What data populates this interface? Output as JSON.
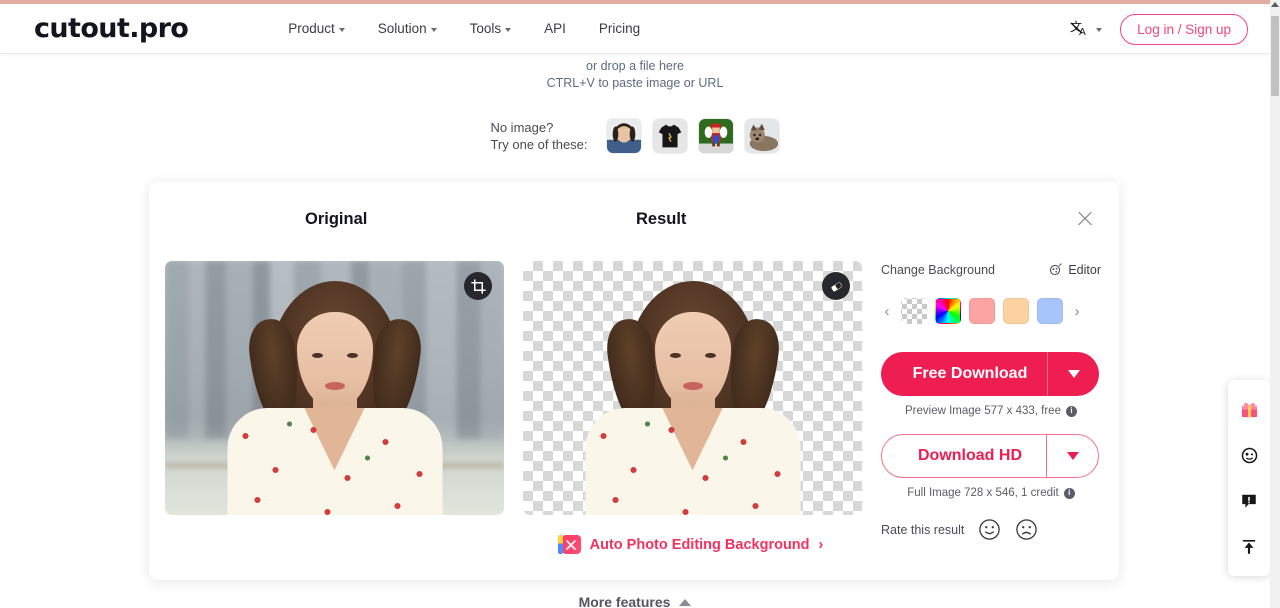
{
  "header": {
    "logo": "cutout.pro",
    "nav": [
      {
        "label": "Product",
        "has_caret": true
      },
      {
        "label": "Solution",
        "has_caret": true
      },
      {
        "label": "Tools",
        "has_caret": true
      },
      {
        "label": "API",
        "has_caret": false
      },
      {
        "label": "Pricing",
        "has_caret": false
      }
    ],
    "language_icon": "translate-icon",
    "login_label": "Log in / Sign up"
  },
  "upload": {
    "drop_hint": "or drop a file here",
    "paste_hint": "CTRL+V to paste image or URL",
    "no_image_line1": "No image?",
    "no_image_line2": "Try one of these:",
    "samples": [
      {
        "name": "sample-portrait"
      },
      {
        "name": "sample-tshirt"
      },
      {
        "name": "sample-mario"
      },
      {
        "name": "sample-dog"
      }
    ]
  },
  "card": {
    "original_title": "Original",
    "result_title": "Result",
    "close_icon": "close-icon",
    "crop_icon": "crop-icon",
    "eraser_icon": "eraser-icon",
    "auto_edit_link": "Auto Photo Editing Background",
    "auto_edit_chevron": "›"
  },
  "controls": {
    "change_background_label": "Change Background",
    "editor_label": "Editor",
    "prev_arrow": "‹",
    "next_arrow": "›",
    "swatches": [
      {
        "name": "transparent",
        "color": "transparent"
      },
      {
        "name": "rainbow",
        "color": "#ff00ff"
      },
      {
        "name": "pink",
        "color": "#fca3a3"
      },
      {
        "name": "peach",
        "color": "#fcd2a0"
      },
      {
        "name": "blue",
        "color": "#a8c5fb"
      }
    ],
    "free_download_label": "Free Download",
    "free_download_caption": "Preview Image 577 x 433, free",
    "download_hd_label": "Download HD",
    "download_hd_caption": "Full Image 728 x 546, 1 credit",
    "info_glyph": "i",
    "rate_label": "Rate this result",
    "rate_positive_icon": "smiley-happy-icon",
    "rate_negative_icon": "smiley-sad-icon"
  },
  "footer": {
    "more_features_label": "More features"
  },
  "float_toolbar": [
    {
      "name": "gift-icon"
    },
    {
      "name": "avatar-face-icon"
    },
    {
      "name": "feedback-icon"
    },
    {
      "name": "scroll-to-top-icon"
    }
  ],
  "colors": {
    "accent": "#ee1d52",
    "accent_light": "#f3738f",
    "top_accent": "#e3aca2",
    "text": "#2b2b38"
  }
}
